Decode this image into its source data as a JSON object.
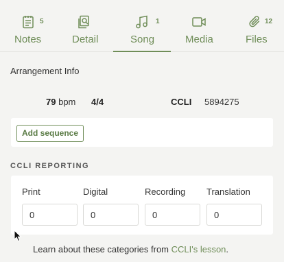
{
  "tabs": [
    {
      "id": "notes",
      "label": "Notes",
      "badge": "5",
      "icon": "notes-icon"
    },
    {
      "id": "detail",
      "label": "Detail",
      "badge": "",
      "icon": "detail-icon"
    },
    {
      "id": "song",
      "label": "Song",
      "badge": "1",
      "icon": "music-note-icon",
      "active": true
    },
    {
      "id": "media",
      "label": "Media",
      "badge": "",
      "icon": "video-camera-icon"
    },
    {
      "id": "files",
      "label": "Files",
      "badge": "12",
      "icon": "paperclip-icon"
    }
  ],
  "arrangement": {
    "title": "Arrangement Info",
    "bpm_value": "79",
    "bpm_unit": "bpm",
    "meter": "4/4",
    "ccli_label": "CCLI",
    "ccli_number": "5894275",
    "add_sequence_label": "Add sequence"
  },
  "ccli_reporting": {
    "title": "CCLI REPORTING",
    "fields": [
      {
        "label": "Print",
        "value": "0"
      },
      {
        "label": "Digital",
        "value": "0"
      },
      {
        "label": "Recording",
        "value": "0"
      },
      {
        "label": "Translation",
        "value": "0"
      }
    ],
    "footer_text": "Learn about these categories from ",
    "footer_link": "CCLI's lesson",
    "footer_end": "."
  },
  "colors": {
    "accent": "#6f8d58",
    "background": "#f4f4f2",
    "card": "#ffffff"
  }
}
